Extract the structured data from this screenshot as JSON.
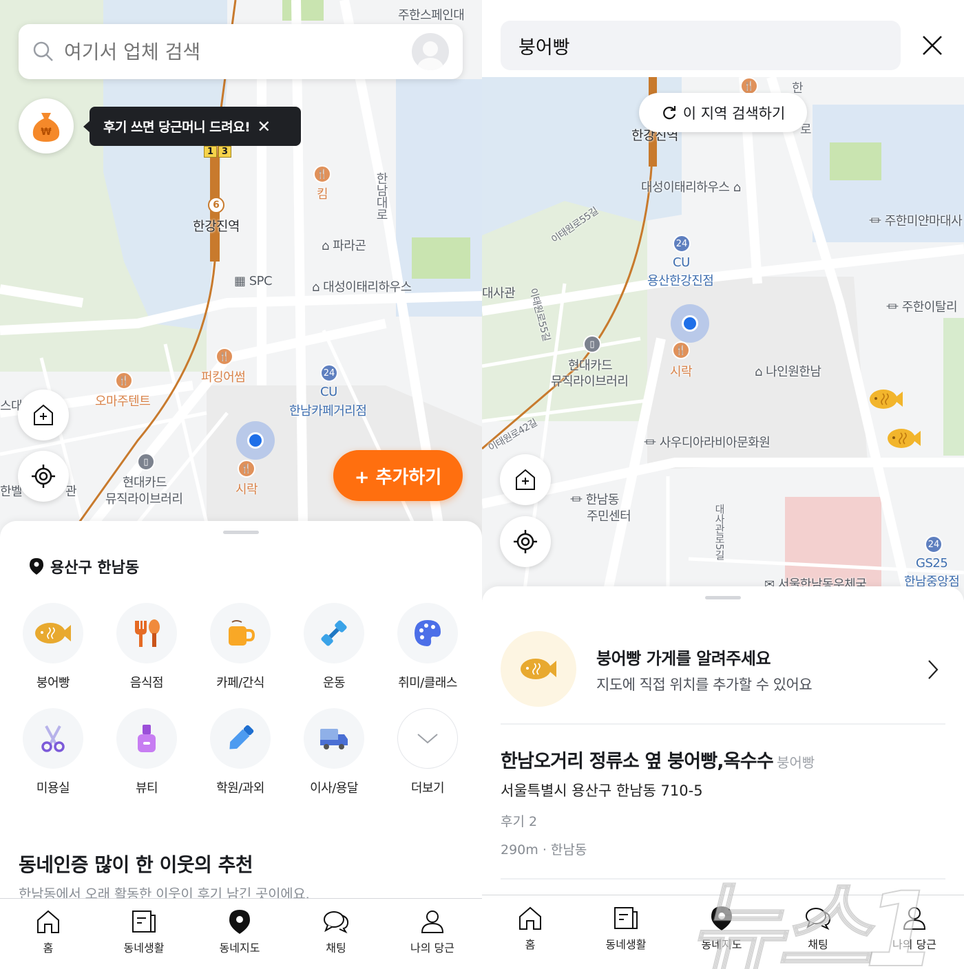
{
  "left": {
    "search": {
      "placeholder": "여기서 업체 검색"
    },
    "tooltip": {
      "text": "후기 쓰면 당근머니 드려요!"
    },
    "add_button": {
      "label": "+ 추가하기"
    },
    "map": {
      "labels": [
        "주한스페인대",
        "한강진역",
        "킴",
        "한남대로",
        "파라곤",
        "SPC",
        "대성이태리하우스",
        "퍼킹어썸",
        "오마주텐트",
        "CU",
        "한남카페거리점",
        "현대카드",
        "뮤직라이브러리",
        "시락",
        "스대",
        "한벨",
        "관"
      ],
      "station_badges": [
        "1",
        "3",
        "6"
      ]
    },
    "sheet": {
      "location": "용산구 한남동",
      "categories": [
        {
          "label": "붕어빵",
          "icon": "fish-bread-icon"
        },
        {
          "label": "음식점",
          "icon": "fork-spoon-icon"
        },
        {
          "label": "카페/간식",
          "icon": "coffee-mug-icon"
        },
        {
          "label": "운동",
          "icon": "dumbbell-icon"
        },
        {
          "label": "취미/클래스",
          "icon": "palette-icon"
        },
        {
          "label": "미용실",
          "icon": "scissors-icon"
        },
        {
          "label": "뷰티",
          "icon": "nail-polish-icon"
        },
        {
          "label": "학원/과외",
          "icon": "pencil-icon"
        },
        {
          "label": "이사/용달",
          "icon": "truck-icon"
        },
        {
          "label": "더보기",
          "icon": "chevron-down-icon"
        }
      ],
      "section_title": "동네인증 많이 한 이웃의 추천",
      "section_subtitle": "한남동에서 오래 활동한 이웃이 후기 남긴 곳이에요."
    }
  },
  "right": {
    "search": {
      "value": "붕어빵"
    },
    "search_area_button": "이 지역 검색하기",
    "map": {
      "labels": [
        "한강진역",
        "대성이태리하우스",
        "이태원로55길",
        "주한미얀마대사",
        "CU",
        "용산한강진점",
        "대사관",
        "주한이탈리",
        "현대카드",
        "뮤직라이브러리",
        "시락",
        "나인원한남",
        "이태원로42길",
        "사우디아라비아문화원",
        "한남동",
        "주민센터",
        "대사관로5길",
        "GS25",
        "한남중앙점",
        "서울한남동우체국",
        "한",
        "로",
        "이태원로55길"
      ]
    },
    "banner": {
      "title": "붕어빵 가게를 알려주세요",
      "subtitle": "지도에 직접 위치를 추가할 수 있어요"
    },
    "results": [
      {
        "name": "한남오거리 정류소 옆 붕어빵,옥수수",
        "category": "붕어빵",
        "address": "서울특별시 용산구 한남동 710-5",
        "reviews": "후기 2",
        "distance": "290m · 한남동"
      }
    ]
  },
  "nav": {
    "items": [
      "홈",
      "동네생활",
      "동네지도",
      "채팅",
      "나의 당근"
    ],
    "active": "동네지도"
  },
  "watermark": "뉴스1",
  "colors": {
    "brand": "#FF6F0F",
    "location_dot": "#1f6fe8",
    "fish": "#e8a92f"
  }
}
